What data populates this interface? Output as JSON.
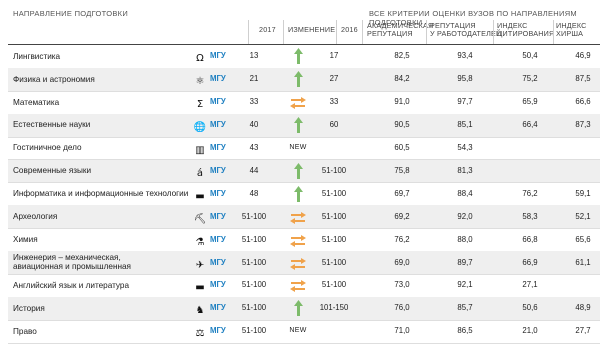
{
  "header": {
    "section_label": "НАПРАВЛЕНИЕ ПОДГОТОВКИ",
    "criteria_label": "ВСЕ КРИТЕРИИ ОЦЕНКИ ВУЗОВ ПО НАПРАВЛЕНИЯМ ПОДГОТОВКИ",
    "col_2017": "2017",
    "col_change": "ИЗМЕНЕНИЕ",
    "col_2016": "2016",
    "col_academic": "АКАДЕМИЧЕСКАЯ\nРЕПУТАЦИЯ",
    "col_employer": "РЕПУТАЦИЯ\nУ РАБОТОДАТЕЛЕЙ",
    "col_citation": "ИНДЕКС\nЦИТИРОВАНИЯ",
    "col_hirsch": "ИНДЕКС\nХИРША"
  },
  "colors": {
    "up_arrow": "#7dbb6a",
    "swap_arrow": "#f0a24a",
    "university": "#1d7fc1",
    "alt_row": "#efefef"
  },
  "rows": [
    {
      "subject": "Лингвистика",
      "icon": "omega-icon",
      "icon_glyph": "Ω",
      "university": "МГУ",
      "rank2017": "13",
      "change": "up",
      "rank2016": "17",
      "academic": "82,5",
      "employer": "93,4",
      "citation": "50,4",
      "hirsch": "46,9"
    },
    {
      "subject": "Физика и астрономия",
      "icon": "atom-icon",
      "icon_glyph": "⚛",
      "university": "МГУ",
      "rank2017": "21",
      "change": "up",
      "rank2016": "27",
      "academic": "84,2",
      "employer": "95,8",
      "citation": "75,2",
      "hirsch": "87,5"
    },
    {
      "subject": "Математика",
      "icon": "sigma-icon",
      "icon_glyph": "Σ",
      "university": "МГУ",
      "rank2017": "33",
      "change": "swap",
      "rank2016": "33",
      "academic": "91,0",
      "employer": "97,7",
      "citation": "65,9",
      "hirsch": "66,6"
    },
    {
      "subject": "Естественные науки",
      "icon": "globe-icon",
      "icon_glyph": "🌐",
      "university": "МГУ",
      "rank2017": "40",
      "change": "up",
      "rank2016": "60",
      "academic": "90,5",
      "employer": "85,1",
      "citation": "66,4",
      "hirsch": "87,3"
    },
    {
      "subject": "Гостиничное дело",
      "icon": "building-icon",
      "icon_glyph": "▥",
      "university": "МГУ",
      "rank2017": "43",
      "change": "new",
      "change_text": "NEW",
      "rank2016": "",
      "academic": "60,5",
      "employer": "54,3",
      "citation": "",
      "hirsch": ""
    },
    {
      "subject": "Современные языки",
      "icon": "letter-a-icon",
      "icon_glyph": "á",
      "university": "МГУ",
      "rank2017": "44",
      "change": "up",
      "rank2016": "51-100",
      "academic": "75,8",
      "employer": "81,3",
      "citation": "",
      "hirsch": ""
    },
    {
      "subject": "Информатика и информационные технологии",
      "icon": "computer-icon",
      "icon_glyph": "▬",
      "university": "МГУ",
      "rank2017": "48",
      "change": "up",
      "rank2016": "51-100",
      "academic": "69,7",
      "employer": "88,4",
      "citation": "76,2",
      "hirsch": "59,1"
    },
    {
      "subject": "Археология",
      "icon": "excavator-icon",
      "icon_glyph": "⛏",
      "university": "МГУ",
      "rank2017": "51-100",
      "change": "swap",
      "rank2016": "51-100",
      "academic": "69,2",
      "employer": "92,0",
      "citation": "58,3",
      "hirsch": "52,1"
    },
    {
      "subject": "Химия",
      "icon": "flask-icon",
      "icon_glyph": "⚗",
      "university": "МГУ",
      "rank2017": "51-100",
      "change": "swap",
      "rank2016": "51-100",
      "academic": "76,2",
      "employer": "88,0",
      "citation": "66,8",
      "hirsch": "65,6"
    },
    {
      "subject": "Инженерия – механическая,\nавиационная и промышленная",
      "icon": "airplane-icon",
      "icon_glyph": "✈",
      "university": "МГУ",
      "rank2017": "51-100",
      "change": "swap",
      "rank2016": "51-100",
      "academic": "69,0",
      "employer": "89,7",
      "citation": "66,9",
      "hirsch": "61,1"
    },
    {
      "subject": "Английский язык и литература",
      "icon": "book-icon",
      "icon_glyph": "▬",
      "university": "МГУ",
      "rank2017": "51-100",
      "change": "swap",
      "rank2016": "51-100",
      "academic": "73,0",
      "employer": "92,1",
      "citation": "27,1",
      "hirsch": ""
    },
    {
      "subject": "История",
      "icon": "knight-icon",
      "icon_glyph": "♞",
      "university": "МГУ",
      "rank2017": "51-100",
      "change": "up",
      "rank2016": "101-150",
      "academic": "76,0",
      "employer": "85,7",
      "citation": "50,6",
      "hirsch": "48,9"
    },
    {
      "subject": "Право",
      "icon": "scales-icon",
      "icon_glyph": "⚖",
      "university": "МГУ",
      "rank2017": "51-100",
      "change": "new",
      "change_text": "NEW",
      "rank2016": "",
      "academic": "71,0",
      "employer": "86,5",
      "citation": "21,0",
      "hirsch": "27,7"
    }
  ]
}
